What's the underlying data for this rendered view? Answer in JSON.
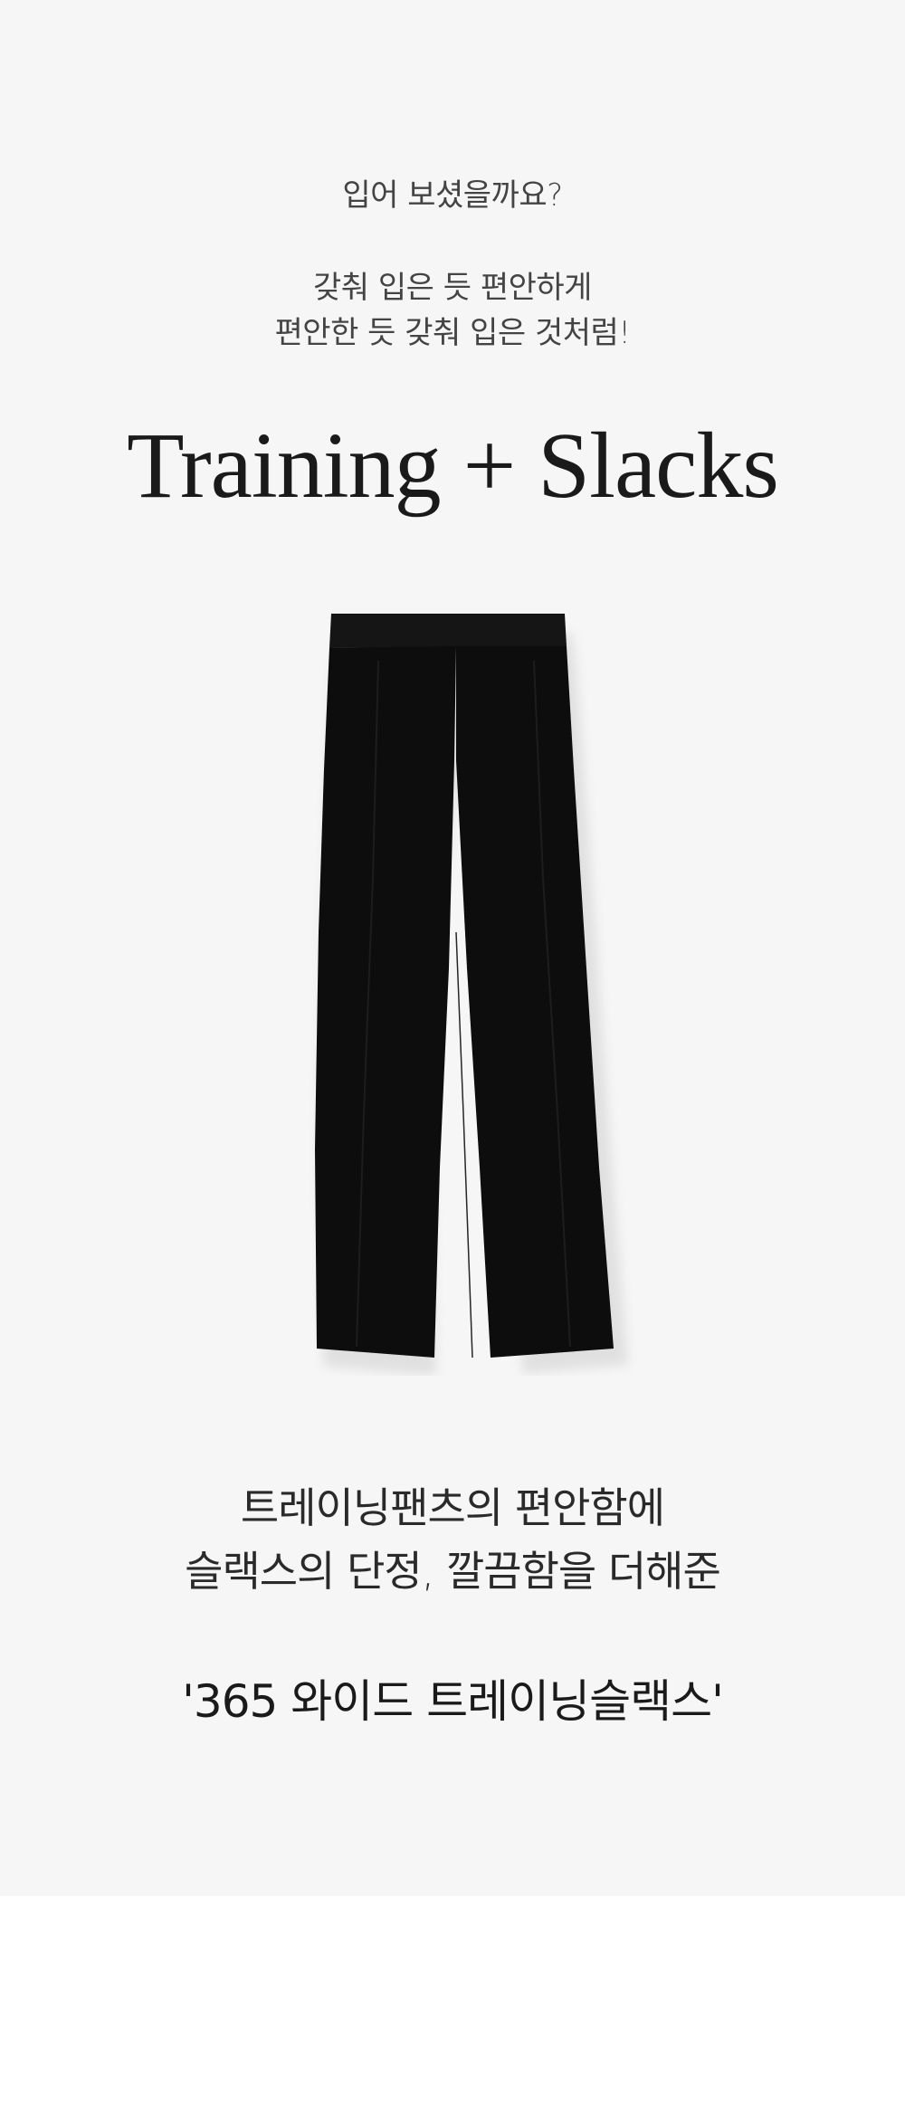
{
  "intro": {
    "question": "입어 보셨을까요?",
    "line1": "갖춰 입은 듯 편안하게",
    "line2": "편안한 듯 갖춰 입은 것처럼!"
  },
  "headline": "Training + Slacks",
  "product_image": {
    "icon": "black-wide-pants-image",
    "color": "#0d0d0d"
  },
  "description": {
    "line1": "트레이닝팬츠의 편안함에",
    "line2": "슬랙스의 단정, 깔끔함을 더해준"
  },
  "product_name": "'365 와이드 트레이닝슬랙스'",
  "colors": {
    "section_background": "#f6f6f6",
    "page_background": "#ffffff",
    "text_dark": "#1a1a1a"
  }
}
